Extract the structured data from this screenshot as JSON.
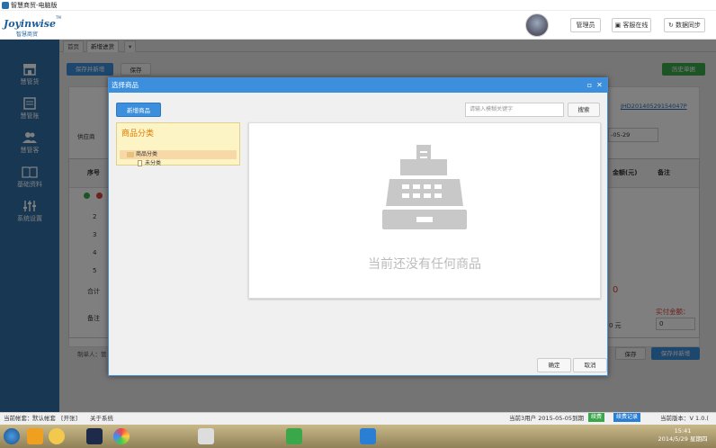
{
  "window": {
    "title": "智慧商贸-电脑版"
  },
  "header": {
    "brand": "Joyinwise",
    "brand_sub": "智慧商贸",
    "brand_tm": "TM",
    "admin_button": "管理员",
    "service_button": "客服在线",
    "sync_button": "数据同步"
  },
  "tabs": [
    {
      "label": "首页"
    },
    {
      "label": "新增进货"
    },
    {
      "label": "▾"
    }
  ],
  "sidebar": {
    "items": [
      {
        "label": "慧管货",
        "icon": "store-icon"
      },
      {
        "label": "慧管账",
        "icon": "ledger-icon"
      },
      {
        "label": "慧管客",
        "icon": "users-icon"
      },
      {
        "label": "基础资料",
        "icon": "book-icon"
      },
      {
        "label": "系统设置",
        "icon": "settings-icon"
      }
    ]
  },
  "background": {
    "save_new_label": "保存并新增",
    "save_label": "保存",
    "history_label": "历史单据",
    "order_no": "JHD20140529154047P",
    "supplier_label": "供应商",
    "date_value": "-05-29",
    "col_seq": "序号",
    "col_amount": "金额(元)",
    "col_note": "备注",
    "rows": [
      "2",
      "3",
      "4",
      "5"
    ],
    "total_label": "合计",
    "total_value": "0",
    "remark_label": "备注",
    "paid_label": "实付金额：",
    "paid_value": "0",
    "due_value": "0 元",
    "maker_label": "制单人：管",
    "save_label2": "保存",
    "save_new_label2": "保存并新增"
  },
  "dialog": {
    "title": "选择商品",
    "new_product_button": "新增商品",
    "search_placeholder": "请输入模糊关键字",
    "search_button": "搜索",
    "category_title": "商品分类",
    "category_root": "商品分类",
    "category_child": "未分类",
    "empty_message": "当前还没有任何商品",
    "confirm_button": "确定",
    "cancel_button": "取消"
  },
  "statusbar": {
    "current_account_label": "当前帐套：",
    "current_account": "默认帐套",
    "switch_label": "[开张]",
    "about_label": "关于系统",
    "user_info": "当前3用户 2015-05-05到期",
    "renew_badge": "续费",
    "record_badge": "续费记录",
    "version_label": "当前版本：V 1.0.("
  },
  "taskbar": {
    "time": "15:41",
    "date": "2014/5/29 星期四"
  },
  "colors": {
    "sidebar": "#2f6ea6",
    "accent_blue": "#3c8fdc",
    "category_bg": "#fdf4c5",
    "category_title": "#e07b00",
    "renew_green": "#3aa84a",
    "record_blue": "#2a7fd4"
  }
}
